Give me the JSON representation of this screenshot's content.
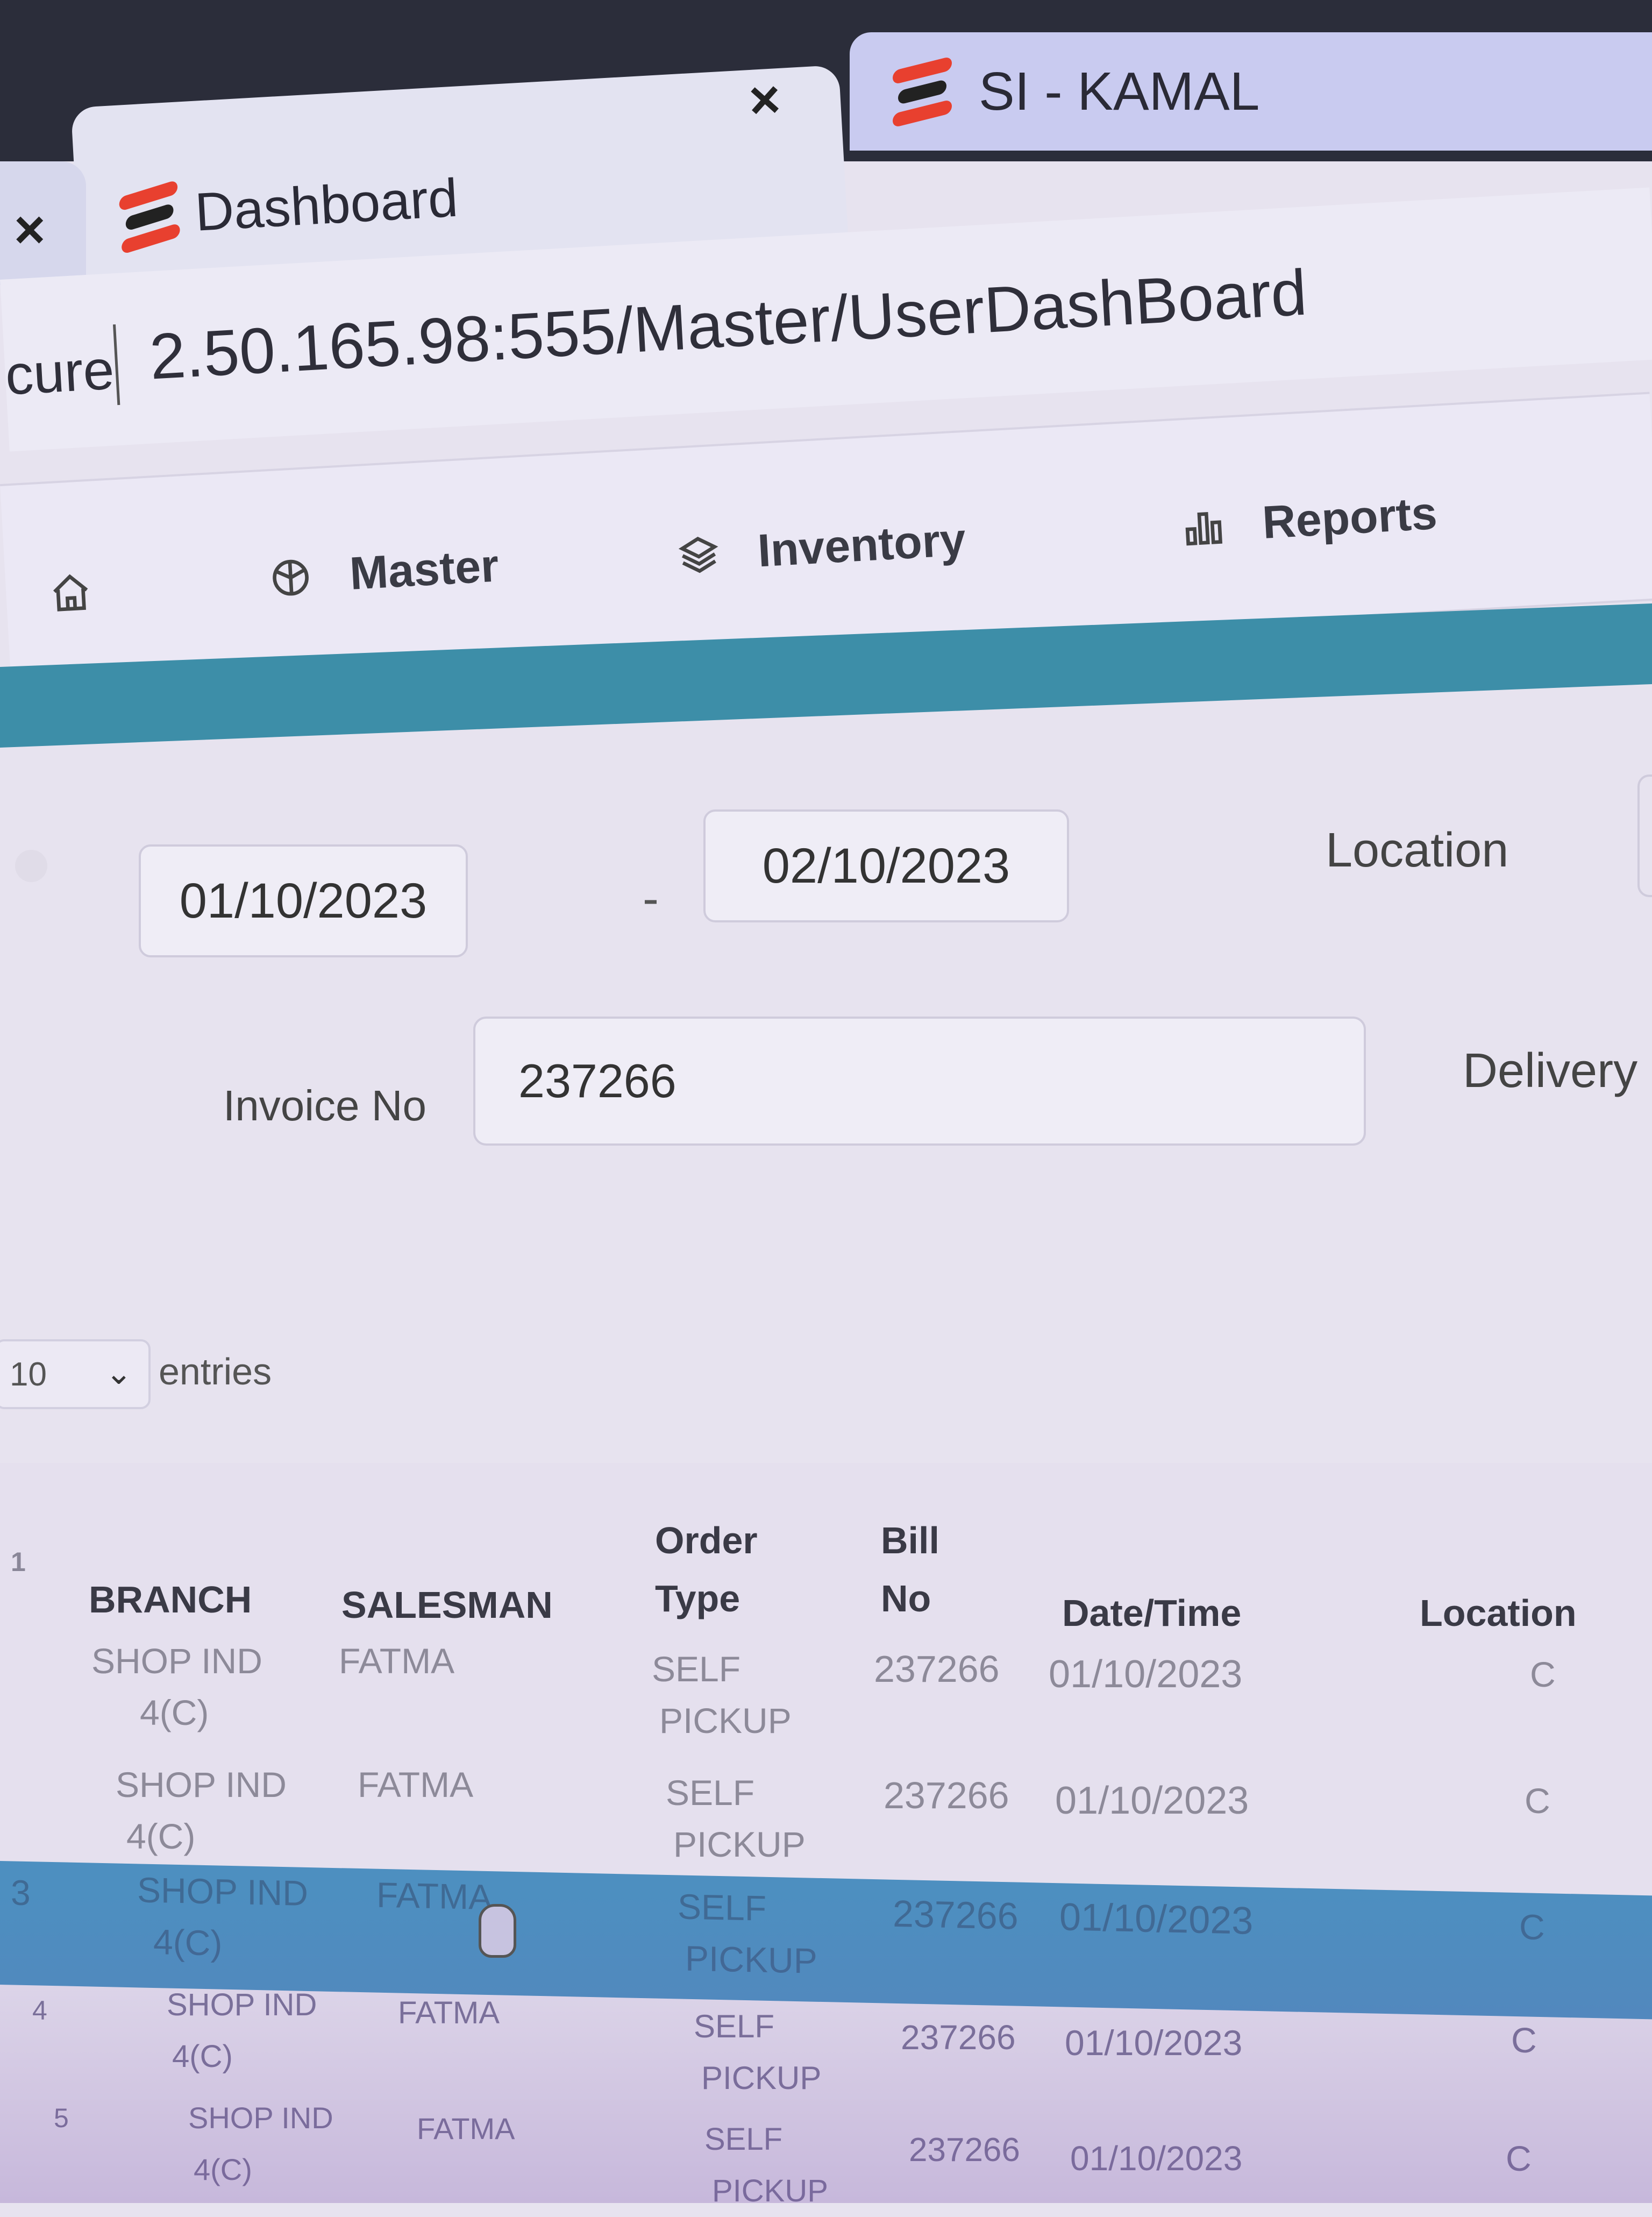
{
  "browser": {
    "tabs": [
      {
        "title": "Dashboard",
        "close": "×"
      },
      {
        "title": "SI - KAMAL",
        "close": "×"
      }
    ],
    "left_tab_close": "×",
    "address": {
      "scheme_fragment": "cure",
      "url": "2.50.165.98:555/Master/UserDashBoard"
    }
  },
  "nav": {
    "items": [
      {
        "label": "",
        "icon": "home-icon"
      },
      {
        "label": "Master",
        "icon": "cube-icon"
      },
      {
        "label": "Inventory",
        "icon": "layers-icon"
      },
      {
        "label": "Reports",
        "icon": "bar-chart-icon"
      }
    ]
  },
  "filters": {
    "date_from": "01/10/2023",
    "date_separator": "-",
    "date_to": "02/10/2023",
    "location_label": "Location",
    "invoice_label": "Invoice No",
    "invoice_value": "237266",
    "delivery_label": "Delivery"
  },
  "entries": {
    "value": "10",
    "label": "entries"
  },
  "table": {
    "index_header": "1",
    "headers": {
      "branch": "BRANCH",
      "salesman": "SALESMAN",
      "order_type_line1": "Order",
      "order_type_line2": "Type",
      "bill_no_line1": "Bill",
      "bill_no_line2": "No",
      "datetime": "Date/Time",
      "location": "Location"
    },
    "rows": [
      {
        "index": "",
        "branch_line1": "SHOP IND",
        "branch_line2": "4(C)",
        "salesman": "FATMA",
        "type_line1": "SELF",
        "type_line2": "PICKUP",
        "bill": "237266",
        "date": "01/10/2023",
        "location": "C"
      },
      {
        "index": "",
        "branch_line1": "SHOP IND",
        "branch_line2": "4(C)",
        "salesman": "FATMA",
        "type_line1": "SELF",
        "type_line2": "PICKUP",
        "bill": "237266",
        "date": "01/10/2023",
        "location": "C"
      },
      {
        "index": "3",
        "branch_line1": "SHOP IND",
        "branch_line2": "4(C)",
        "salesman": "FATMA",
        "type_line1": "SELF",
        "type_line2": "PICKUP",
        "bill": "237266",
        "date": "01/10/2023",
        "location": "C"
      },
      {
        "index": "4",
        "branch_line1": "SHOP IND",
        "branch_line2": "4(C)",
        "salesman": "FATMA",
        "type_line1": "SELF",
        "type_line2": "PICKUP",
        "bill": "237266",
        "date": "01/10/2023",
        "location": "C"
      },
      {
        "index": "5",
        "branch_line1": "SHOP IND",
        "branch_line2": "4(C)",
        "salesman": "FATMA",
        "type_line1": "SELF",
        "type_line2": "PICKUP",
        "bill": "237266",
        "date": "01/10/2023",
        "location": "C"
      }
    ]
  }
}
